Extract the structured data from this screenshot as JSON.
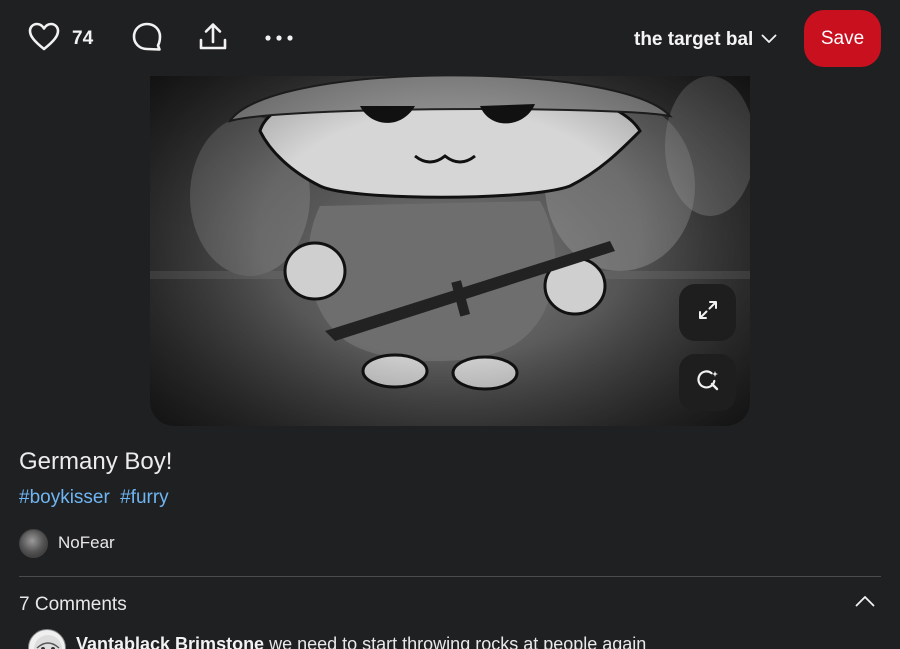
{
  "toolbar": {
    "like_icon": "heart-icon",
    "like_count": "74",
    "comment_icon": "comment-bubble-icon",
    "share_icon": "share-upload-icon",
    "more_icon": "ellipsis-icon",
    "board_name": "the target bal",
    "board_icon": "chevron-down-icon",
    "save_label": "Save"
  },
  "image": {
    "expand_icon": "expand-arrows-icon",
    "lens_icon": "visual-search-lens-icon"
  },
  "pin": {
    "title": "Germany Boy!",
    "tags": [
      "#boykisser",
      "#furry"
    ]
  },
  "creator": {
    "name": "NoFear"
  },
  "comments": {
    "count_label": "7 Comments",
    "collapse_icon": "chevron-up-icon",
    "items": [
      {
        "author": "Vantablack Brimstone",
        "text": "we need to start throwing rocks at people again"
      }
    ]
  },
  "colors": {
    "background": "#1f2022",
    "save_button": "#c8101f",
    "tag_link": "#6fb5f2",
    "text": "#e9e9e9"
  }
}
